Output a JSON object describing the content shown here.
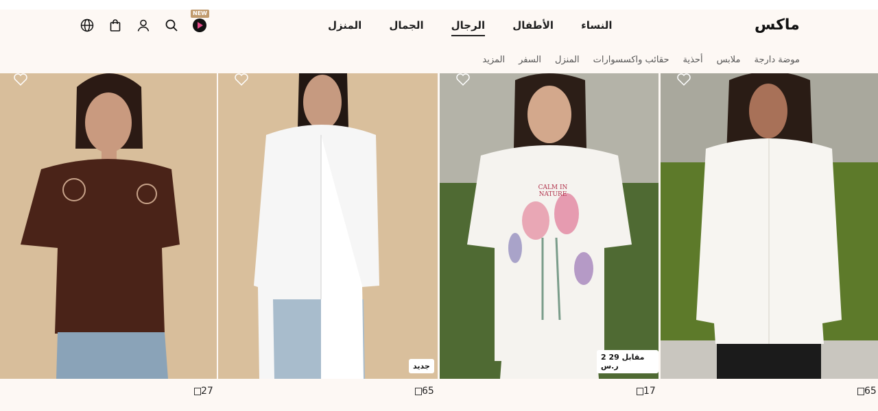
{
  "brand": {
    "logo": "ماكس"
  },
  "header": {
    "new_badge": "NEW",
    "icons": [
      "globe-icon",
      "bag-icon",
      "user-icon",
      "search-icon",
      "play-icon"
    ],
    "main_nav": [
      {
        "label": "النساء",
        "active": false
      },
      {
        "label": "الأطفال",
        "active": false
      },
      {
        "label": "الرجال",
        "active": true
      },
      {
        "label": "الجمال",
        "active": false
      },
      {
        "label": "المنزل",
        "active": false
      }
    ],
    "sub_nav": [
      "موضة دارجة",
      "ملابس",
      "أحذية",
      "حقائب واكسسوارات",
      "المنزل",
      "السفر",
      "المزيد"
    ]
  },
  "products": [
    {
      "price": "27",
      "tag": "",
      "art_text": ""
    },
    {
      "price": "65",
      "tag": "جديد",
      "art_text": ""
    },
    {
      "price": "17",
      "tag": "2 مقابل 29 ر.س",
      "art_text": "CALM IN NATURE"
    },
    {
      "price": "65",
      "tag": "",
      "art_text": ""
    }
  ],
  "colors": {
    "background": "#fdf8f4",
    "beige_backdrop": "#d9bf9c",
    "brown_tee": "#4a2318"
  }
}
